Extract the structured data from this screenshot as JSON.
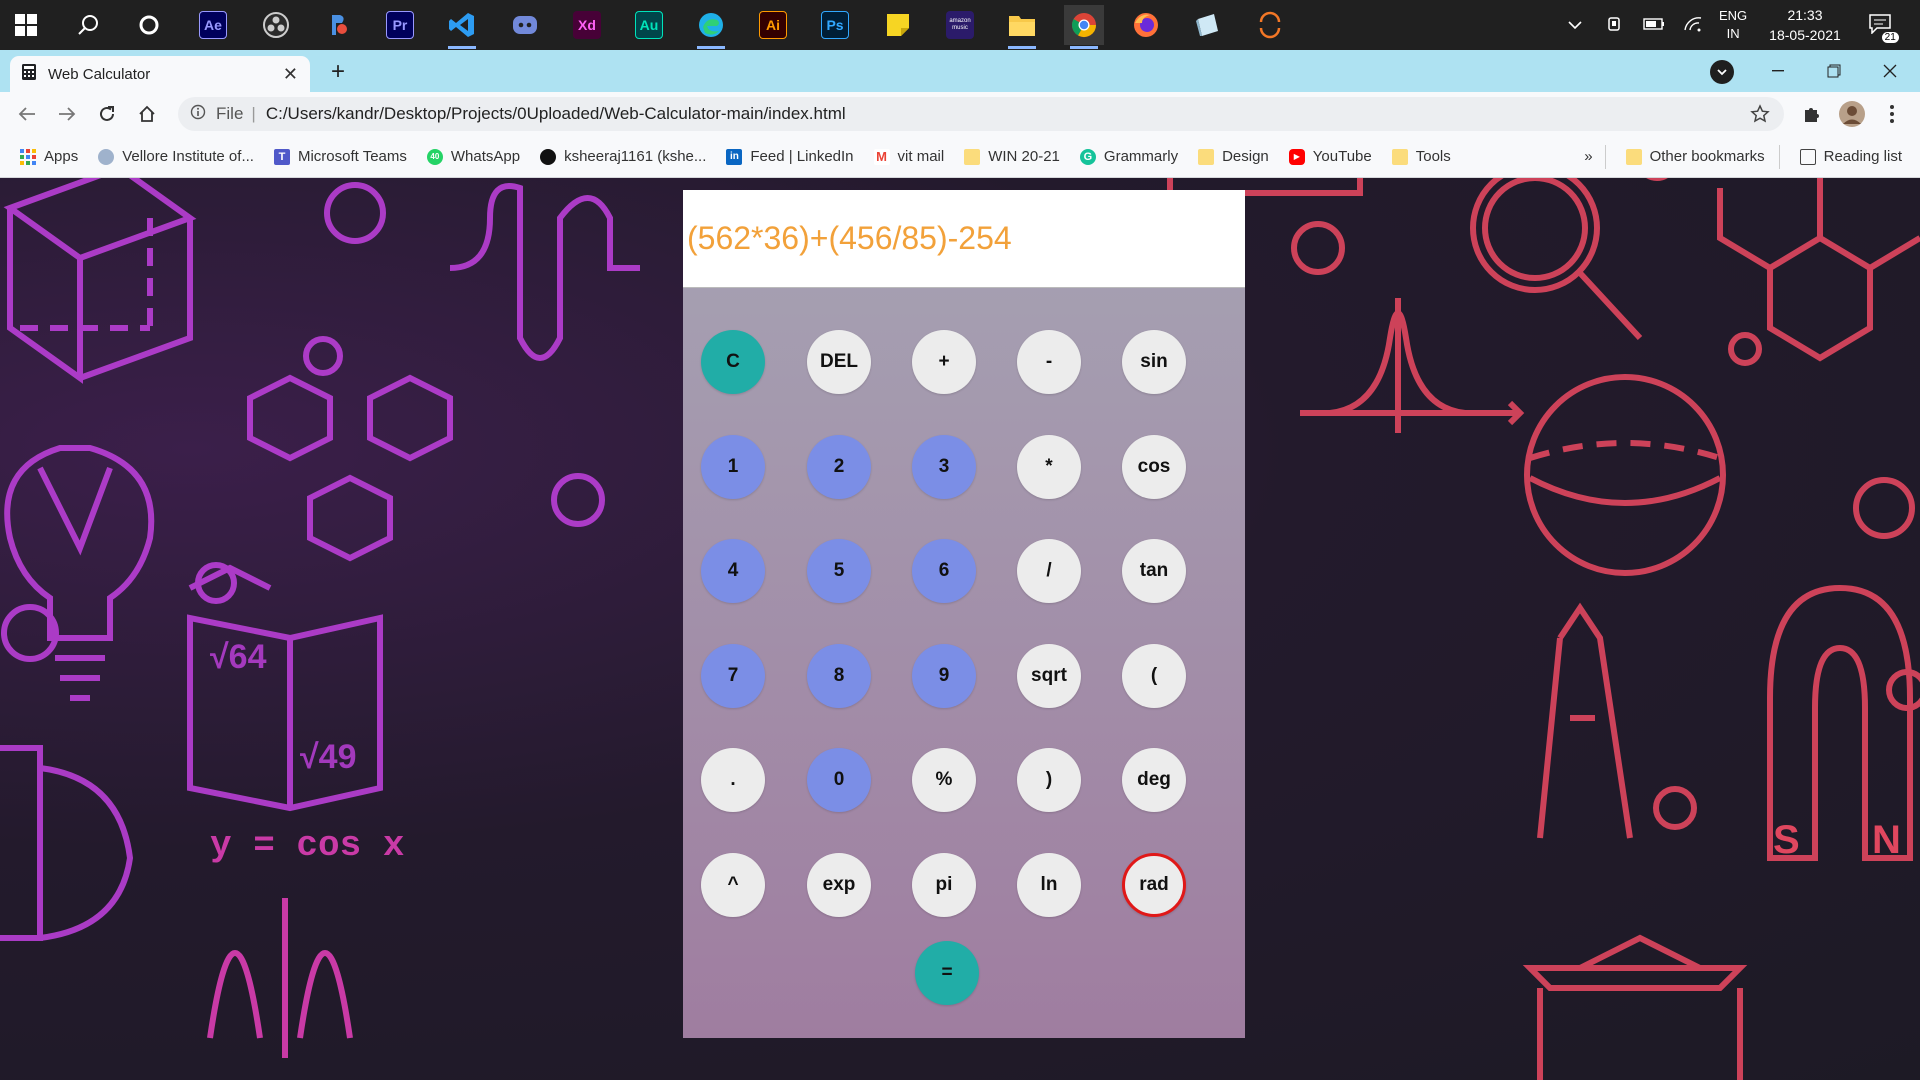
{
  "taskbar": {
    "apps": [
      {
        "name": "after-effects",
        "label": "Ae",
        "color": "#9999ff",
        "bg": "#00005b"
      },
      {
        "name": "premiere-pro",
        "label": "Pr",
        "color": "#9999ff",
        "bg": "#00005b"
      },
      {
        "name": "xd",
        "label": "Xd",
        "color": "#ff61f6",
        "bg": "#470137"
      },
      {
        "name": "audition",
        "label": "Au",
        "color": "#00e4bb",
        "bg": "#00005b"
      },
      {
        "name": "illustrator",
        "label": "Ai",
        "color": "#ff9a00",
        "bg": "#330000"
      },
      {
        "name": "photoshop",
        "label": "Ps",
        "color": "#31a8ff",
        "bg": "#001e36"
      }
    ],
    "amazon_music_label": "amazon music",
    "tray": {
      "language_top": "ENG",
      "language_bottom": "IN",
      "time": "21:33",
      "date": "18-05-2021",
      "notification_count": "21"
    }
  },
  "browser": {
    "tab_title": "Web Calculator",
    "new_tab_label": "+",
    "address": {
      "scheme_label": "File",
      "url": "C:/Users/kandr/Desktop/Projects/0Uploaded/Web-Calculator-main/index.html"
    },
    "bookmarks": [
      {
        "label": "Apps",
        "icon": "apps-grid-icon"
      },
      {
        "label": "Vellore Institute of...",
        "icon": "vit-icon"
      },
      {
        "label": "Microsoft Teams",
        "icon": "teams-icon"
      },
      {
        "label": "WhatsApp",
        "icon": "whatsapp-icon"
      },
      {
        "label": "ksheeraj1161 (kshe...",
        "icon": "github-icon"
      },
      {
        "label": "Feed | LinkedIn",
        "icon": "linkedin-icon"
      },
      {
        "label": "vit mail",
        "icon": "gmail-icon"
      },
      {
        "label": "WIN 20-21",
        "icon": "folder-icon"
      },
      {
        "label": "Grammarly",
        "icon": "grammarly-icon"
      },
      {
        "label": "Design",
        "icon": "folder-icon"
      },
      {
        "label": "YouTube",
        "icon": "youtube-icon"
      },
      {
        "label": "Tools",
        "icon": "folder-icon"
      }
    ],
    "overflow_label": "»",
    "other_bookmarks": "Other bookmarks",
    "reading_list": "Reading list"
  },
  "calculator": {
    "display": "(562*36)+(456/85)-254",
    "rows": [
      [
        {
          "label": "C",
          "kind": "teal"
        },
        {
          "label": "DEL",
          "kind": "op"
        },
        {
          "label": "+",
          "kind": "op"
        },
        {
          "label": "-",
          "kind": "op"
        },
        {
          "label": "sin",
          "kind": "op"
        }
      ],
      [
        {
          "label": "1",
          "kind": "num"
        },
        {
          "label": "2",
          "kind": "num"
        },
        {
          "label": "3",
          "kind": "num"
        },
        {
          "label": "*",
          "kind": "op"
        },
        {
          "label": "cos",
          "kind": "op"
        }
      ],
      [
        {
          "label": "4",
          "kind": "num"
        },
        {
          "label": "5",
          "kind": "num"
        },
        {
          "label": "6",
          "kind": "num"
        },
        {
          "label": "/",
          "kind": "op"
        },
        {
          "label": "tan",
          "kind": "op"
        }
      ],
      [
        {
          "label": "7",
          "kind": "num"
        },
        {
          "label": "8",
          "kind": "num"
        },
        {
          "label": "9",
          "kind": "num"
        },
        {
          "label": "sqrt",
          "kind": "op"
        },
        {
          "label": "(",
          "kind": "op"
        }
      ],
      [
        {
          "label": ".",
          "kind": "op"
        },
        {
          "label": "0",
          "kind": "num"
        },
        {
          "label": "%",
          "kind": "op"
        },
        {
          "label": ")",
          "kind": "op"
        },
        {
          "label": "deg",
          "kind": "op"
        }
      ],
      [
        {
          "label": "^",
          "kind": "op"
        },
        {
          "label": "exp",
          "kind": "op"
        },
        {
          "label": "pi",
          "kind": "op"
        },
        {
          "label": "ln",
          "kind": "op"
        },
        {
          "label": "rad",
          "kind": "active"
        }
      ]
    ],
    "equals_label": "=",
    "colors": {
      "number_key": "#7b8ee6",
      "teal_key": "#21ada7",
      "op_key": "#ececec",
      "display_text": "#f2a13a",
      "active_ring": "#e01818"
    }
  },
  "background": {
    "formula_text": "y = cos x",
    "book_text_1": "√64",
    "book_text_2": "√49",
    "magnet_s": "S",
    "magnet_n": "N"
  }
}
